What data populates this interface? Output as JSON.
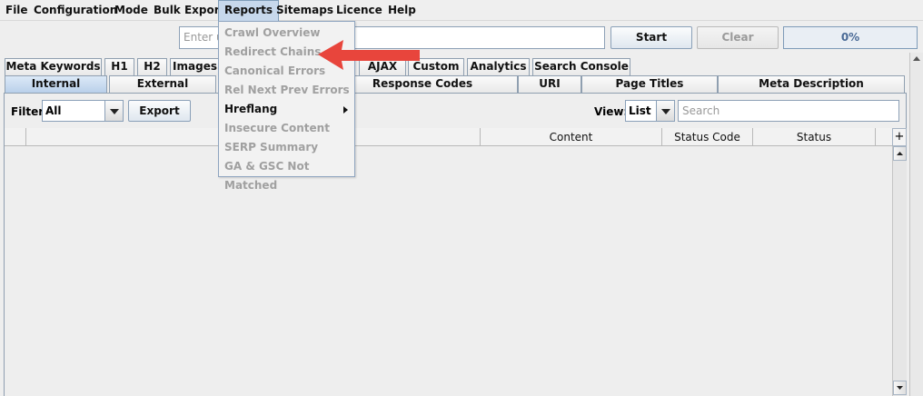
{
  "menu": [
    "File",
    "Configuration",
    "Mode",
    "Bulk Export",
    "Reports",
    "Sitemaps",
    "Licence",
    "Help"
  ],
  "toolbar": {
    "url_placeholder": "Enter u",
    "start": "Start",
    "clear": "Clear",
    "progress": "0%"
  },
  "tabs_row1": [
    "Meta Keywords",
    "H1",
    "H2",
    "Images",
    "AJAX",
    "Custom",
    "Analytics",
    "Search Console"
  ],
  "tabs_row2": [
    "Internal",
    "External",
    "Response Codes",
    "URI",
    "Page Titles",
    "Meta Description"
  ],
  "filter": {
    "label": "Filter:",
    "value": "All",
    "export": "Export"
  },
  "view": {
    "label": "View:",
    "value": "List",
    "search_placeholder": "Search"
  },
  "columns": [
    "",
    "Content",
    "Status Code",
    "Status"
  ],
  "plus": "+",
  "reports_menu": {
    "items": [
      {
        "label": "Crawl Overview",
        "enabled": false
      },
      {
        "label": "Redirect Chains",
        "enabled": false
      },
      {
        "label": "Canonical Errors",
        "enabled": false
      },
      {
        "label": "Rel Next Prev Errors",
        "enabled": false
      },
      {
        "label": "Hreflang",
        "enabled": true,
        "submenu": true
      },
      {
        "label": "Insecure Content",
        "enabled": false
      },
      {
        "label": "SERP Summary",
        "enabled": false
      },
      {
        "label": "GA & GSC Not Matched",
        "enabled": false
      }
    ]
  },
  "colors": {
    "annotation_arrow": "#e8453c",
    "selection": "#c7d8ec"
  }
}
